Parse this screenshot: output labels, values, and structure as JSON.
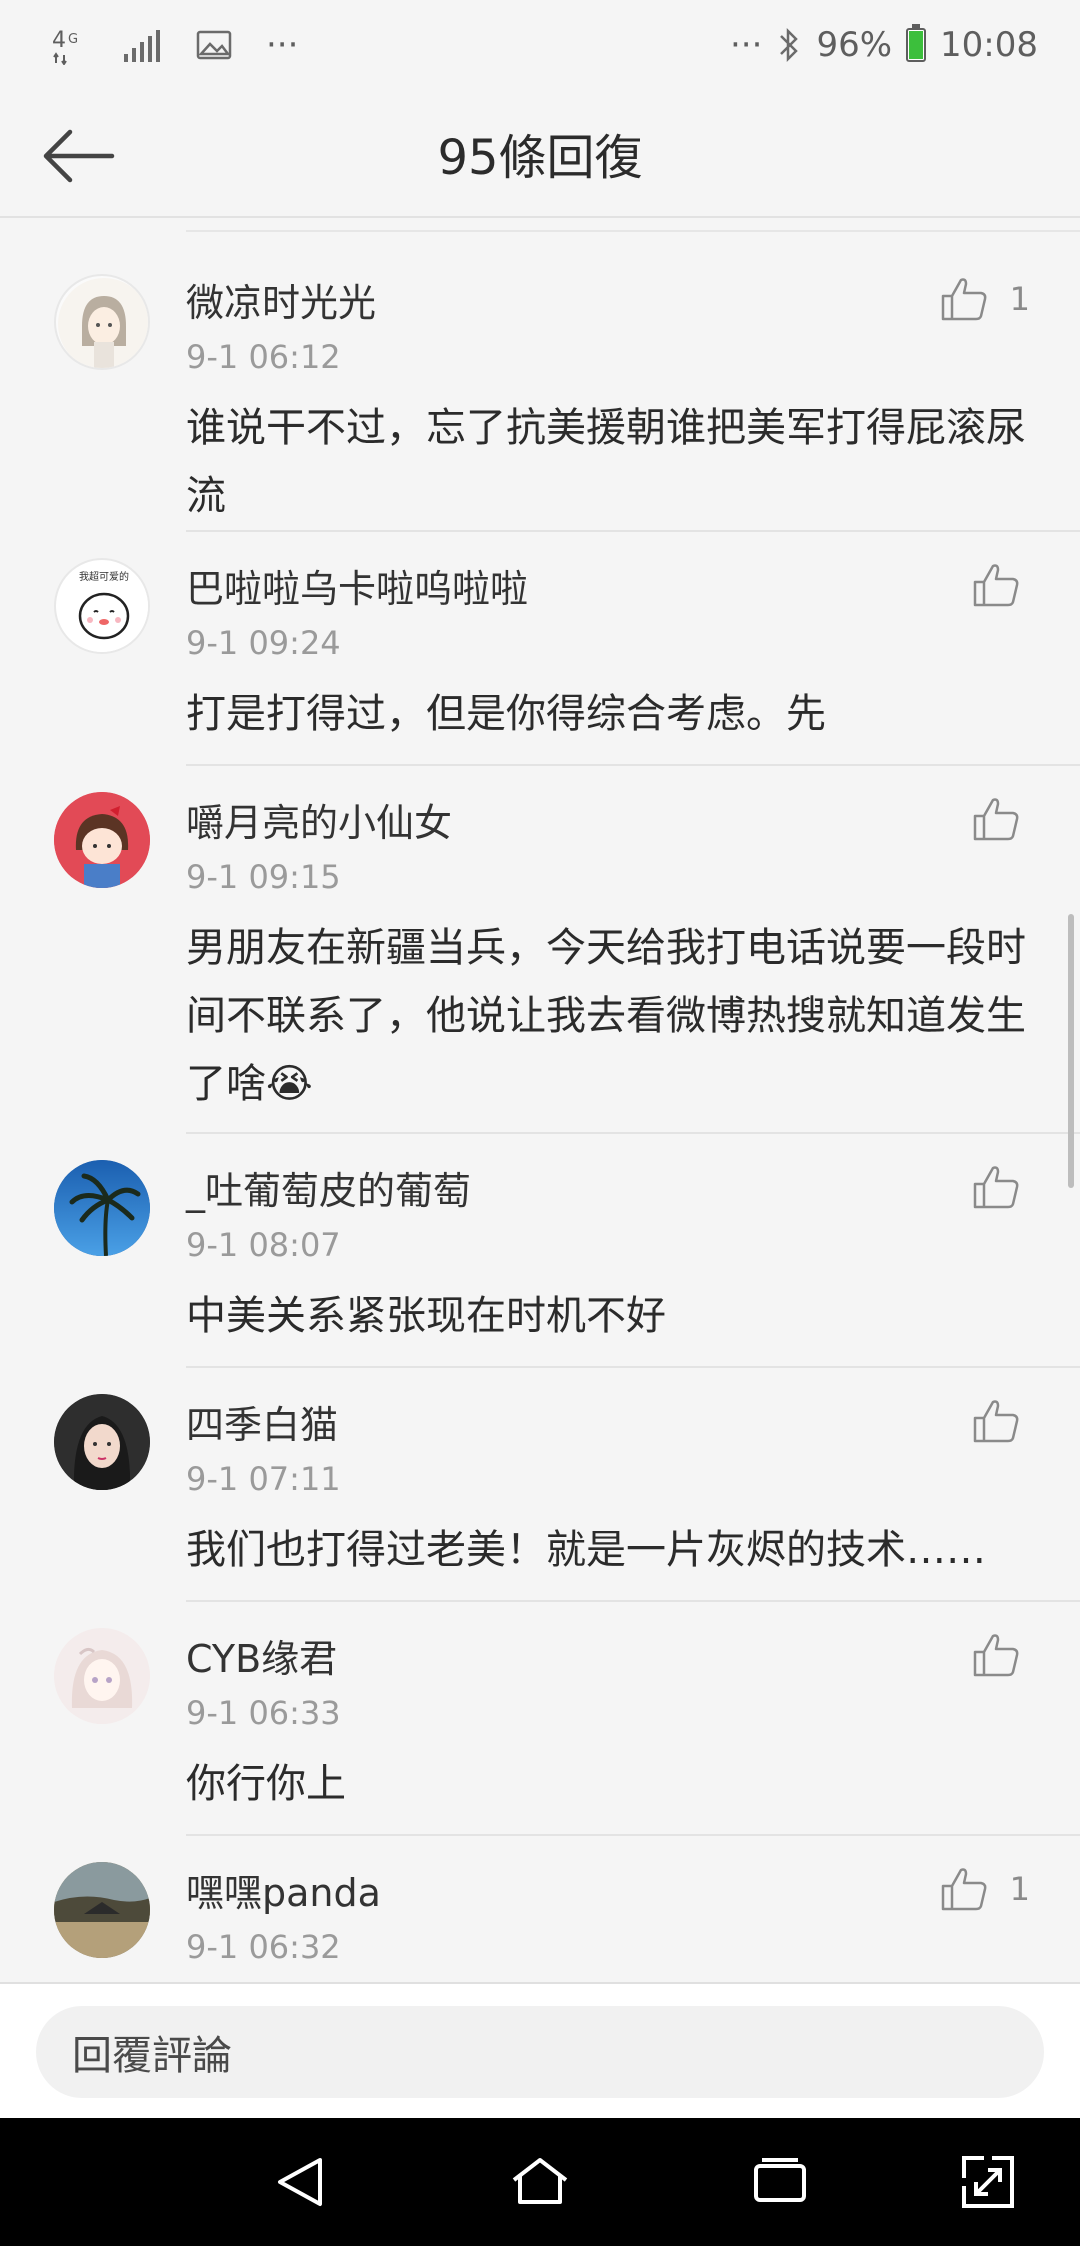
{
  "status_bar": {
    "network": "4G",
    "more_left": "···",
    "more_right": "···",
    "battery": "96%",
    "time": "10:08"
  },
  "header": {
    "title": "95條回復"
  },
  "comments": [
    {
      "username": "微凉时光光",
      "time": "9-1 06:12",
      "content": "谁说干不过，忘了抗美援朝谁把美军打得屁滚尿流",
      "likes": "1",
      "avatar": "girl-illustration"
    },
    {
      "username": "巴啦啦乌卡啦呜啦啦",
      "time": "9-1 09:24",
      "content": "打是打得过，但是你得综合考虑。先",
      "likes": "",
      "avatar_text": "我超可爱的"
    },
    {
      "username": "嚼月亮的小仙女",
      "time": "9-1 09:15",
      "content": "男朋友在新疆当兵，今天给我打电话说要一段时间不联系了，他说让我去看微博热搜就知道发生了啥😭",
      "likes": "",
      "avatar": "cartoon-girl"
    },
    {
      "username": "_吐葡萄皮的葡萄",
      "time": "9-1 08:07",
      "content": "中美关系紧张现在时机不好",
      "likes": "",
      "avatar": "palm-tree"
    },
    {
      "username": "四季白猫",
      "time": "9-1 07:11",
      "content": "我们也打得过老美！就是一片灰烬的技术……",
      "likes": "",
      "avatar": "girl-photo"
    },
    {
      "username": "CYB缘君",
      "time": "9-1 06:33",
      "content": "你行你上",
      "likes": "",
      "avatar": "anime-girl"
    },
    {
      "username": "嘿嘿panda",
      "time": "9-1 06:32",
      "content": "",
      "likes": "1",
      "avatar": "landscape"
    }
  ],
  "reply": {
    "placeholder": "回覆評論"
  },
  "icons": {
    "back": "arrow-left-icon",
    "like": "thumbs-up-icon",
    "nav_back": "triangle-back-icon",
    "nav_home": "home-icon",
    "nav_recent": "recent-apps-icon",
    "nav_expand": "expand-icon"
  },
  "colors": {
    "background": "#f5f5f5",
    "text": "#2b2b2b",
    "muted": "#9a9a9a",
    "battery": "#3cbf3c"
  }
}
